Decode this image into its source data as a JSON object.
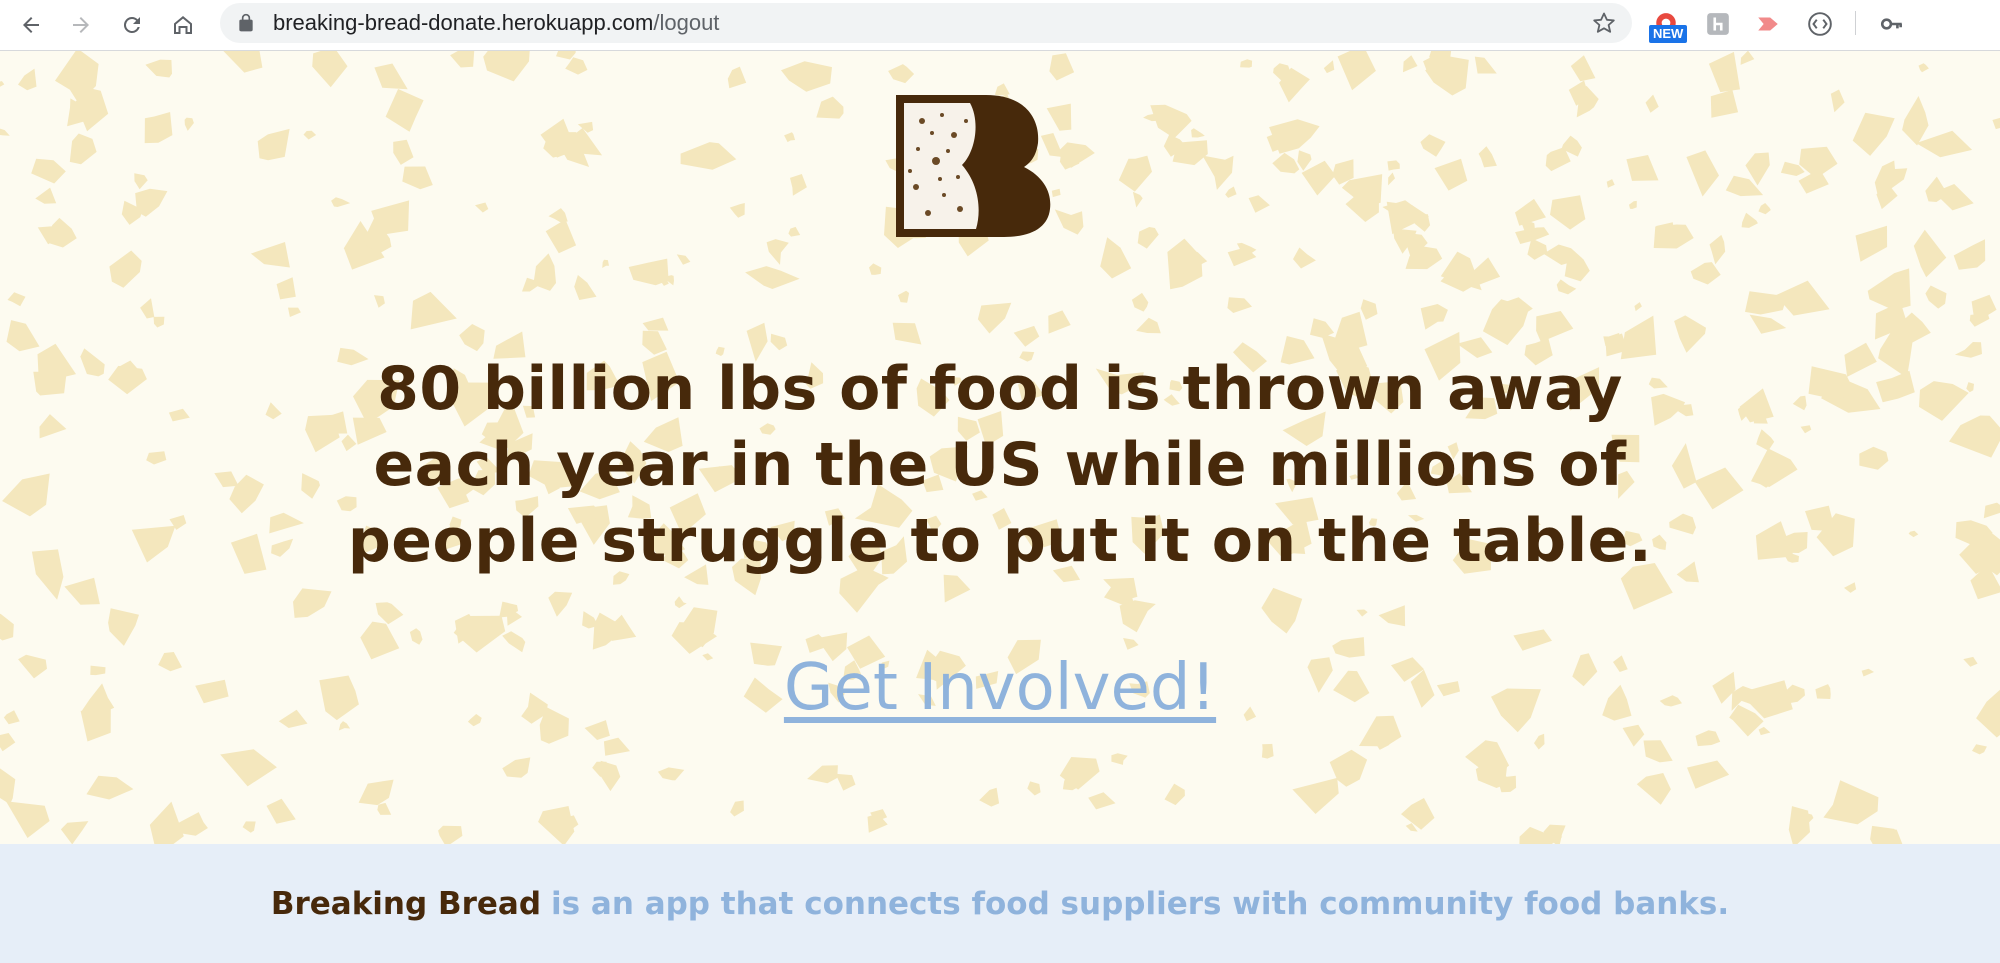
{
  "browser": {
    "url_host": "breaking-bread-donate.herokuapp.com",
    "url_path": "/logout",
    "extension_badge": "NEW",
    "icons": [
      "back-icon",
      "forward-icon",
      "reload-icon",
      "home-icon",
      "lock-icon",
      "bookmark-star-icon",
      "extension-new-icon",
      "extension-h-icon",
      "extension-arrow-icon",
      "extension-code-icon",
      "key-icon"
    ]
  },
  "hero": {
    "headline": "80 billion lbs of food is thrown away each year in the US while millions of people struggle to put it on the table.",
    "cta_label": "Get Involved!"
  },
  "footer": {
    "brand": "Breaking Bread",
    "description": "is an app that connects food suppliers with community food banks."
  },
  "colors": {
    "brown": "#47290b",
    "accent_blue": "#8fb3dc",
    "hero_background": "#fdfbf0",
    "speckle": "#f4e7bd",
    "footer_background": "#e6eef8"
  }
}
